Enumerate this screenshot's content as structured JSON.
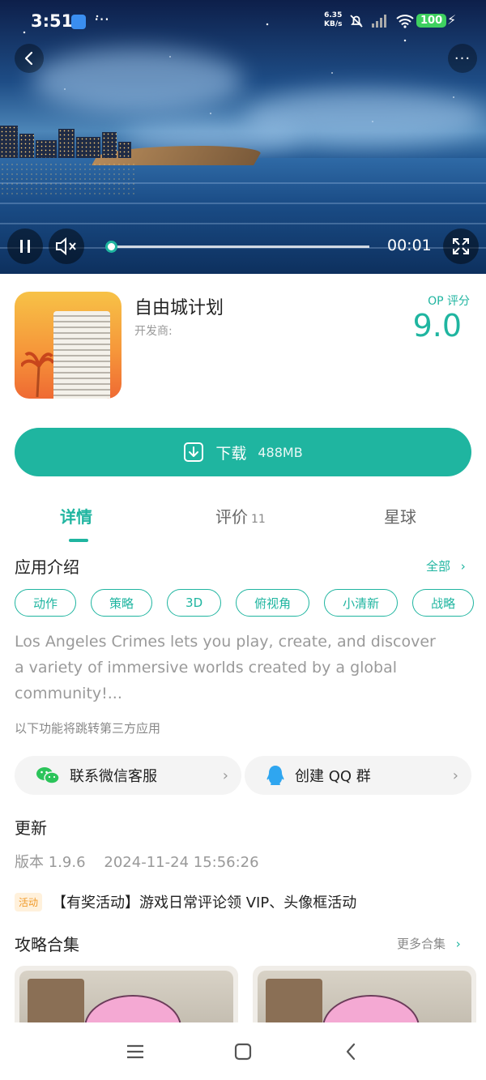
{
  "status_bar": {
    "time": "3:51",
    "more_dots": "···",
    "net_speed_value": "6.35",
    "net_speed_unit": "KB/s",
    "battery": "100"
  },
  "video": {
    "time": "00:01",
    "progress": 0.0
  },
  "app": {
    "name": "自由城计划",
    "developer_label": "开发商:",
    "score_label": "OP 评分",
    "score": "9.0"
  },
  "download": {
    "label": "下载",
    "size": "488MB"
  },
  "tabs": [
    {
      "label": "详情",
      "count": ""
    },
    {
      "label": "评价",
      "count": "11"
    },
    {
      "label": "星球",
      "count": ""
    }
  ],
  "intro": {
    "title": "应用介绍",
    "all_label": "全部",
    "tags": [
      "动作",
      "策略",
      "3D",
      "俯视角",
      "小清新",
      "战略"
    ],
    "description": "Los Angeles Crimes lets you play, create, and discover a variety of immersive worlds created by a global community!...",
    "jump_note": "以下功能将跳转第三方应用"
  },
  "links": {
    "wechat": "联系微信客服",
    "qq": "创建 QQ 群"
  },
  "update": {
    "title": "更新",
    "version_info": "版本 1.9.6    2024-11-24 15:56:26"
  },
  "activity": {
    "badge": "活动",
    "text": "【有奖活动】游戏日常评论领 VIP、头像框活动"
  },
  "guides": {
    "title": "攻略合集",
    "more_label": "更多合集"
  },
  "colors": {
    "accent": "#1fb5a0"
  }
}
